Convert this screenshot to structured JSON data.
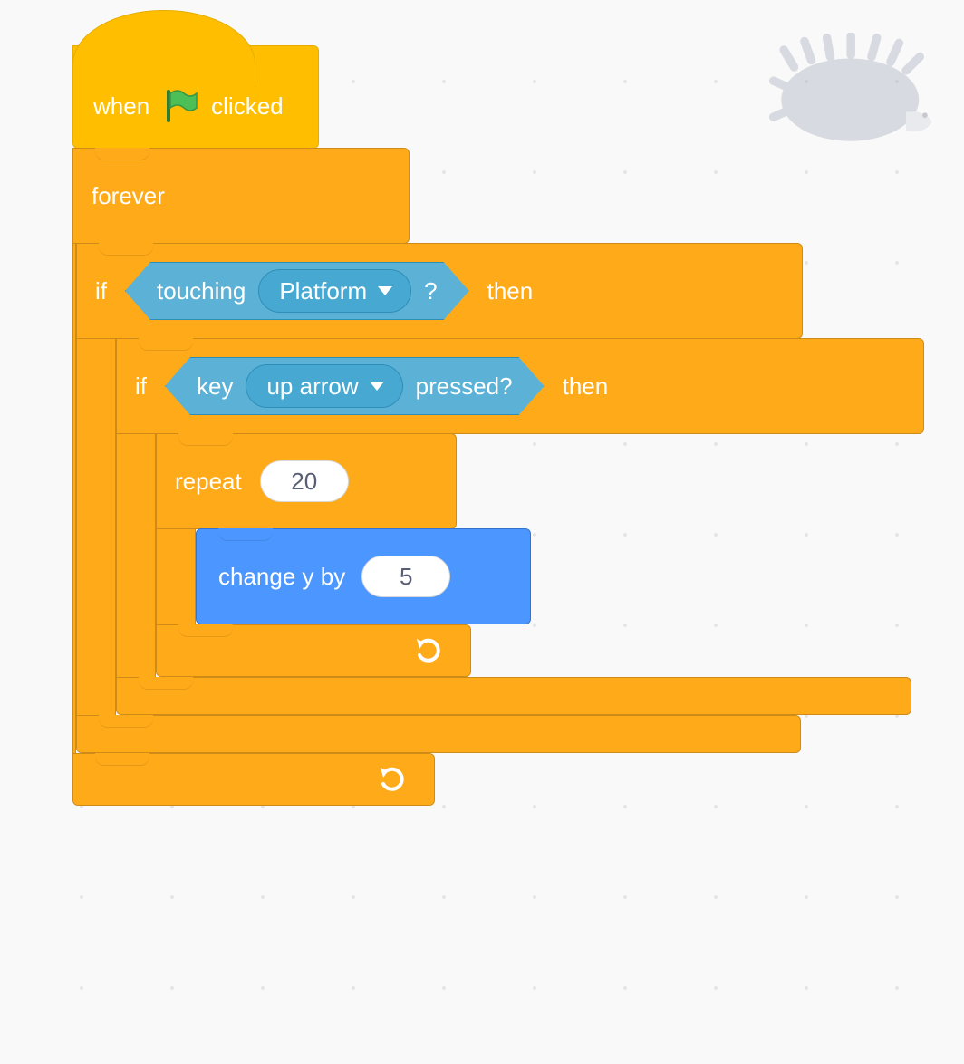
{
  "colors": {
    "events": "#FFBF00",
    "control": "#FFAB19",
    "sensing": "#5CB1D6",
    "motion": "#4C97FF"
  },
  "sprite_watermark": "hedgehog",
  "script": {
    "hat": {
      "prefix": "when",
      "suffix": "clicked",
      "icon": "green-flag"
    },
    "forever": {
      "label": "forever"
    },
    "if1": {
      "if_label": "if",
      "then_label": "then",
      "cond": {
        "prefix": "touching",
        "option": "Platform",
        "suffix": "?"
      }
    },
    "if2": {
      "if_label": "if",
      "then_label": "then",
      "cond": {
        "prefix": "key",
        "option": "up arrow",
        "suffix": "pressed?"
      }
    },
    "repeat": {
      "label": "repeat",
      "count": "20"
    },
    "motion": {
      "label": "change y by",
      "value": "5"
    }
  }
}
